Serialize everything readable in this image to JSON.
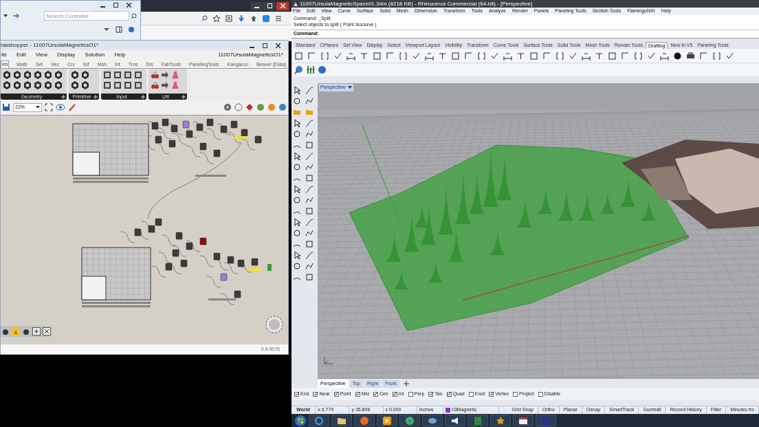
{
  "explorer_window": {
    "search": {
      "placeholder": "Search Controller"
    }
  },
  "grasshopper": {
    "title": "rasshopper - 11007UrsulaMagneticsO1*",
    "menu": [
      "ile",
      "Edit",
      "View",
      "Display",
      "Solution",
      "Help"
    ],
    "document_name": "11007UrsulaMagneticsO1*",
    "tabs": [
      {
        "label": "rm",
        "selected": true
      },
      {
        "label": "Math",
        "selected": false
      },
      {
        "label": "Set",
        "selected": false
      },
      {
        "label": "Vec",
        "selected": false
      },
      {
        "label": "Crv",
        "selected": false
      },
      {
        "label": "Srf",
        "selected": false
      },
      {
        "label": "Msh",
        "selected": false
      },
      {
        "label": "Int",
        "selected": false
      },
      {
        "label": "Trns",
        "selected": false
      },
      {
        "label": "Dis",
        "selected": false
      },
      {
        "label": "FabTools",
        "selected": false
      },
      {
        "label": "PanelingTools",
        "selected": false
      },
      {
        "label": "Kangaroo",
        "selected": false
      },
      {
        "label": "Beaver [Data]",
        "selected": false
      }
    ],
    "panel_groups": [
      "Geometry",
      "Primitive",
      "Input",
      "Util"
    ],
    "zoom": "22%",
    "version": "0.9.0076"
  },
  "rhino": {
    "title": "11007UrsulaMagneticSpace01.3dm (8218 KB) - Rhinoceros Commercial (64-bit) - [Perspective]",
    "menu": [
      "File",
      "Edit",
      "View",
      "Curve",
      "Surface",
      "Solid",
      "Mesh",
      "Dimension",
      "Transform",
      "Tools",
      "Analyze",
      "Render",
      "Panels",
      "Paneling Tools",
      "Section Tools",
      "FlamingoNXt",
      "Help"
    ],
    "command_history": [
      "Command: _Split",
      "Select objects to split ( Point Isocurve )"
    ],
    "command_prompt": "Command:",
    "toolbar_tabs": [
      {
        "label": "Standard",
        "selected": false
      },
      {
        "label": "CPlanes",
        "selected": false
      },
      {
        "label": "Set View",
        "selected": false
      },
      {
        "label": "Display",
        "selected": false
      },
      {
        "label": "Select",
        "selected": false
      },
      {
        "label": "Viewport Layout",
        "selected": false
      },
      {
        "label": "Visibility",
        "selected": false
      },
      {
        "label": "Transform",
        "selected": false
      },
      {
        "label": "Curve Tools",
        "selected": false
      },
      {
        "label": "Surface Tools",
        "selected": false
      },
      {
        "label": "Solid Tools",
        "selected": false
      },
      {
        "label": "Mesh Tools",
        "selected": false
      },
      {
        "label": "Render Tools",
        "selected": false
      },
      {
        "label": "Drafting",
        "selected": true
      },
      {
        "label": "New in V5",
        "selected": false
      },
      {
        "label": "Paneling Tools",
        "selected": false
      }
    ],
    "viewport": {
      "label": "Perspective"
    },
    "viewport_tabs": [
      {
        "label": "Perspective",
        "selected": true
      },
      {
        "label": "Top",
        "selected": false
      },
      {
        "label": "Right",
        "selected": false
      },
      {
        "label": "Front",
        "selected": false
      }
    ],
    "osnaps": [
      {
        "label": "End",
        "checked": true
      },
      {
        "label": "Near",
        "checked": true
      },
      {
        "label": "Point",
        "checked": true
      },
      {
        "label": "Mid",
        "checked": true
      },
      {
        "label": "Cen",
        "checked": true
      },
      {
        "label": "Int",
        "checked": true
      },
      {
        "label": "Perp",
        "checked": false
      },
      {
        "label": "Tan",
        "checked": true
      },
      {
        "label": "Quad",
        "checked": true
      },
      {
        "label": "Knot",
        "checked": false
      },
      {
        "label": "Vertex",
        "checked": true
      },
      {
        "label": "Project",
        "checked": false
      },
      {
        "label": "Disable",
        "checked": false
      }
    ],
    "status_bar": {
      "cplane": "World",
      "x": "x 6.779",
      "y": "y 35.806",
      "z": "z 0.000",
      "units": "Inches",
      "layer": {
        "name": "03Magnetic",
        "color": "#8b2fd6"
      },
      "toggles": [
        "Grid Snap",
        "Ortho",
        "Planar",
        "Osnap",
        "SmartTrack",
        "Gumball",
        "Record History",
        "Filter",
        "Minutes fro"
      ]
    }
  }
}
